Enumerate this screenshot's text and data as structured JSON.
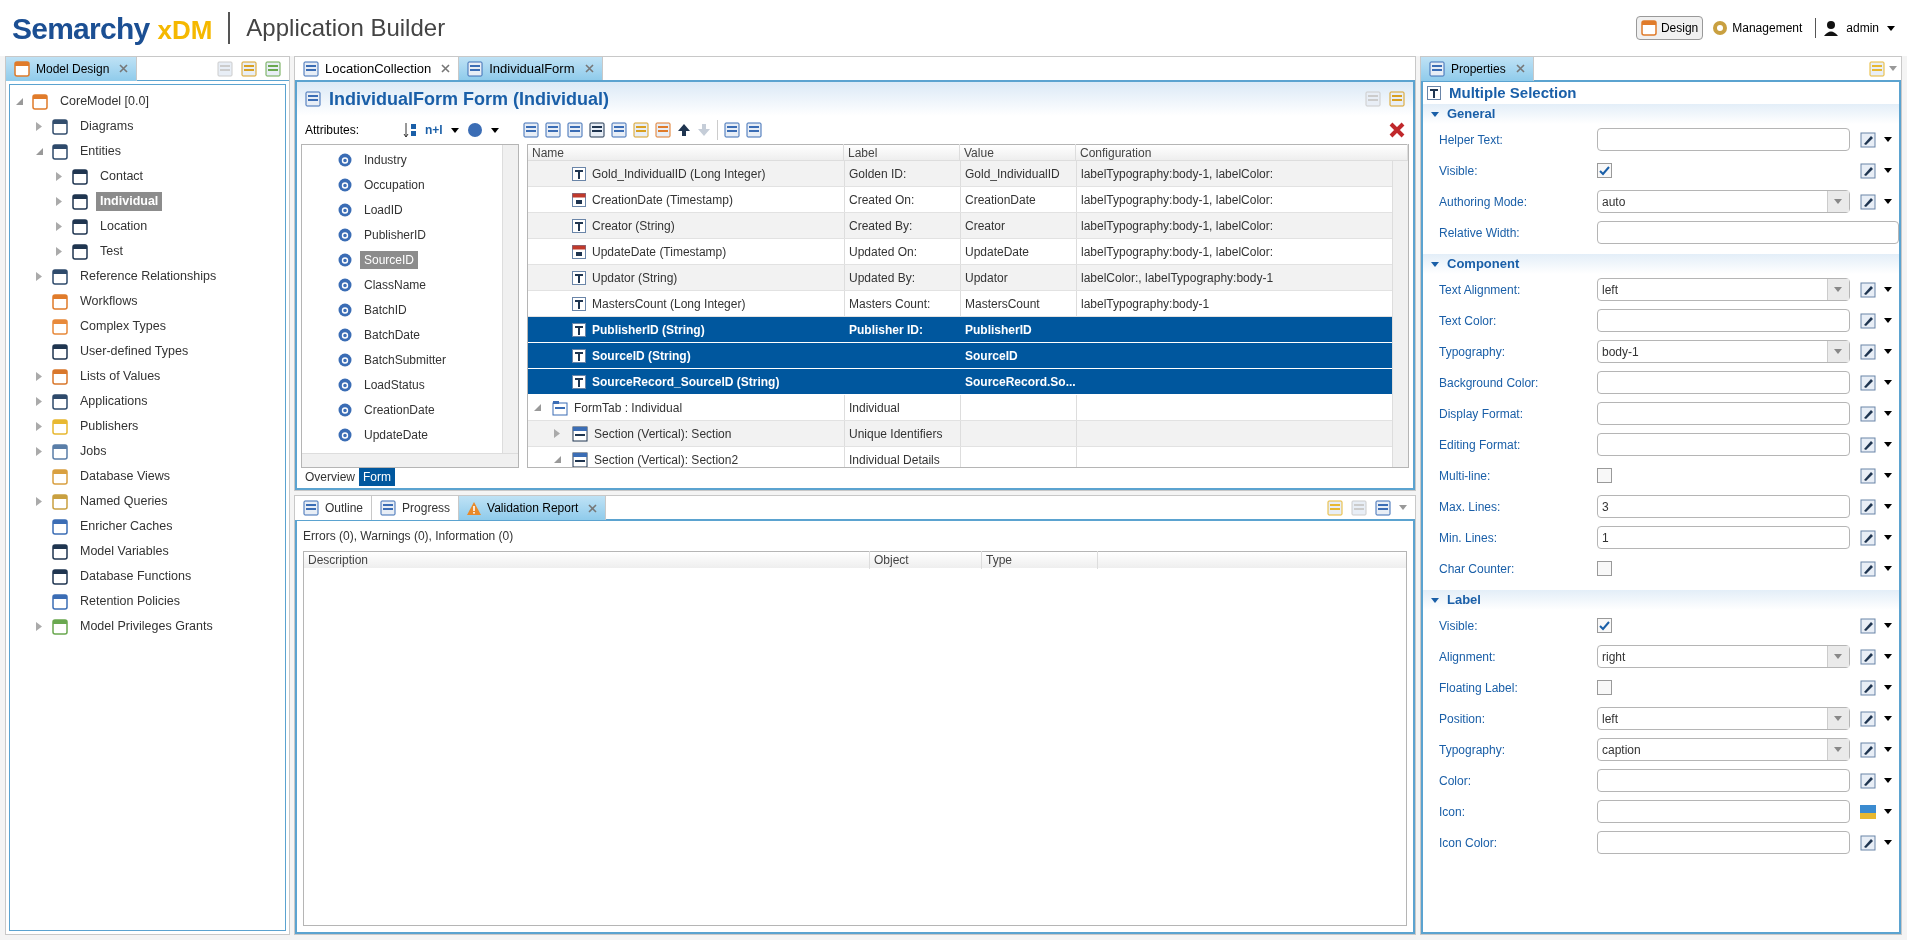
{
  "header": {
    "brand": "Semarchy",
    "product": "xDM",
    "title": "Application Builder",
    "perspectives": [
      {
        "label": "Design",
        "selected": true
      },
      {
        "label": "Management",
        "selected": false
      }
    ],
    "user": "admin"
  },
  "model_design": {
    "tab": "Model Design",
    "tree": [
      {
        "label": "CoreModel [0.0]",
        "expanded": true,
        "selected": false,
        "children": [
          {
            "label": "Diagrams",
            "expanded": false,
            "selected": false
          },
          {
            "label": "Entities",
            "expanded": true,
            "selected": false,
            "children": [
              {
                "label": "Contact",
                "expanded": false,
                "selected": false
              },
              {
                "label": "Individual",
                "expanded": false,
                "selected": true
              },
              {
                "label": "Location",
                "expanded": false,
                "selected": false
              },
              {
                "label": "Test",
                "expanded": false,
                "selected": false
              }
            ]
          },
          {
            "label": "Reference Relationships",
            "expanded": false,
            "selected": false
          },
          {
            "label": "Workflows",
            "selected": false
          },
          {
            "label": "Complex Types",
            "selected": false
          },
          {
            "label": "User-defined Types",
            "selected": false
          },
          {
            "label": "Lists of Values",
            "expanded": false,
            "selected": false
          },
          {
            "label": "Applications",
            "expanded": false,
            "selected": false
          },
          {
            "label": "Publishers",
            "expanded": false,
            "selected": false
          },
          {
            "label": "Jobs",
            "expanded": false,
            "selected": false
          },
          {
            "label": "Database Views",
            "selected": false
          },
          {
            "label": "Named Queries",
            "expanded": false,
            "selected": false
          },
          {
            "label": "Enricher Caches",
            "selected": false
          },
          {
            "label": "Model Variables",
            "selected": false
          },
          {
            "label": "Database Functions",
            "selected": false
          },
          {
            "label": "Retention Policies",
            "selected": false
          },
          {
            "label": "Model Privileges Grants",
            "expanded": false,
            "selected": false
          }
        ]
      }
    ]
  },
  "editor": {
    "tabs": [
      {
        "label": "LocationCollection",
        "selected": false
      },
      {
        "label": "IndividualForm",
        "selected": true
      }
    ],
    "title": "IndividualForm Form (Individual)",
    "attributes_label": "Attributes:",
    "sort_label": "n+l",
    "attributes": [
      {
        "label": "Industry",
        "selected": false
      },
      {
        "label": "Occupation",
        "selected": false
      },
      {
        "label": "LoadID",
        "selected": false
      },
      {
        "label": "PublisherID",
        "selected": false
      },
      {
        "label": "SourceID",
        "selected": true
      },
      {
        "label": "ClassName",
        "selected": false
      },
      {
        "label": "BatchID",
        "selected": false
      },
      {
        "label": "BatchDate",
        "selected": false
      },
      {
        "label": "BatchSubmitter",
        "selected": false
      },
      {
        "label": "LoadStatus",
        "selected": false
      },
      {
        "label": "CreationDate",
        "selected": false
      },
      {
        "label": "UpdateDate",
        "selected": false
      }
    ],
    "table": {
      "columns": [
        "Name",
        "Label",
        "Value",
        "Configuration"
      ],
      "rows": [
        {
          "kind": "text",
          "name": "Gold_IndividualID (Long Integer)",
          "label": "Golden ID:",
          "value": "Gold_IndividualID",
          "configuration": "labelTypography:body-1, labelColor:",
          "selected": false
        },
        {
          "kind": "date",
          "name": "CreationDate (Timestamp)",
          "label": "Created On:",
          "value": "CreationDate",
          "configuration": "labelTypography:body-1, labelColor:",
          "selected": false
        },
        {
          "kind": "text",
          "name": "Creator (String)",
          "label": "Created By:",
          "value": "Creator",
          "configuration": "labelTypography:body-1, labelColor:",
          "selected": false
        },
        {
          "kind": "date",
          "name": "UpdateDate (Timestamp)",
          "label": "Updated On:",
          "value": "UpdateDate",
          "configuration": "labelTypography:body-1, labelColor:",
          "selected": false
        },
        {
          "kind": "text",
          "name": "Updator (String)",
          "label": "Updated By:",
          "value": "Updator",
          "configuration": "labelColor:, labelTypography:body-1",
          "selected": false
        },
        {
          "kind": "text",
          "name": "MastersCount (Long Integer)",
          "label": "Masters Count:",
          "value": "MastersCount",
          "configuration": "labelTypography:body-1",
          "selected": false
        },
        {
          "kind": "text",
          "name": "PublisherID (String)",
          "label": "Publisher ID:",
          "value": "PublisherID",
          "selected": true
        },
        {
          "kind": "text",
          "name": "SourceID (String)",
          "value": "SourceID",
          "selected": true
        },
        {
          "kind": "text",
          "name": "SourceRecord_SourceID (String)",
          "value": "SourceRecord.So...",
          "selected": true
        },
        {
          "kind": "tab",
          "name": "FormTab : Individual",
          "label": "Individual",
          "expanded": true,
          "selected": false,
          "children": [
            {
              "kind": "section",
              "name": "Section (Vertical): Section",
              "label": "Unique Identifiers",
              "expanded": false,
              "selected": false
            },
            {
              "kind": "section",
              "name": "Section (Vertical): Section2",
              "label": "Individual Details",
              "expanded": true,
              "selected": false
            }
          ]
        }
      ]
    },
    "pages": [
      {
        "label": "Overview",
        "selected": false
      },
      {
        "label": "Form",
        "selected": true
      }
    ]
  },
  "bottom": {
    "tabs": [
      {
        "label": "Outline",
        "selected": false
      },
      {
        "label": "Progress",
        "selected": false
      },
      {
        "label": "Validation Report",
        "selected": true
      }
    ],
    "summary": "Errors (0), Warnings (0), Information (0)",
    "columns": [
      "Description",
      "Object",
      "Type"
    ]
  },
  "properties": {
    "tab": "Properties",
    "title": "Multiple Selection",
    "sections": [
      {
        "title": "General",
        "expanded": true,
        "fields": [
          {
            "kind": "text",
            "label": "Helper Text:"
          },
          {
            "kind": "check",
            "label": "Visible:",
            "checked": true
          },
          {
            "kind": "select",
            "label": "Authoring Mode:",
            "value": "auto"
          },
          {
            "kind": "wide",
            "label": "Relative Width:"
          }
        ]
      },
      {
        "title": "Component",
        "expanded": true,
        "fields": [
          {
            "kind": "select",
            "label": "Text Alignment:",
            "value": "left"
          },
          {
            "kind": "text",
            "label": "Text Color:"
          },
          {
            "kind": "select",
            "label": "Typography:",
            "value": "body-1"
          },
          {
            "kind": "text",
            "label": "Background Color:"
          },
          {
            "kind": "text",
            "label": "Display Format:"
          },
          {
            "kind": "text",
            "label": "Editing Format:"
          },
          {
            "kind": "check",
            "label": "Multi-line:",
            "checked": false
          },
          {
            "kind": "text",
            "label": "Max. Lines:",
            "value": "3"
          },
          {
            "kind": "text",
            "label": "Min. Lines:",
            "value": "1"
          },
          {
            "kind": "check",
            "label": "Char Counter:",
            "checked": false
          }
        ]
      },
      {
        "title": "Label",
        "expanded": true,
        "fields": [
          {
            "kind": "check",
            "label": "Visible:",
            "checked": true
          },
          {
            "kind": "select",
            "label": "Alignment:",
            "value": "right"
          },
          {
            "kind": "check",
            "label": "Floating Label:",
            "checked": false
          },
          {
            "kind": "select",
            "label": "Position:",
            "value": "left"
          },
          {
            "kind": "select",
            "label": "Typography:",
            "value": "caption"
          },
          {
            "kind": "text",
            "label": "Color:"
          },
          {
            "kind": "image",
            "label": "Icon:"
          },
          {
            "kind": "text",
            "label": "Icon Color:"
          }
        ]
      }
    ]
  }
}
